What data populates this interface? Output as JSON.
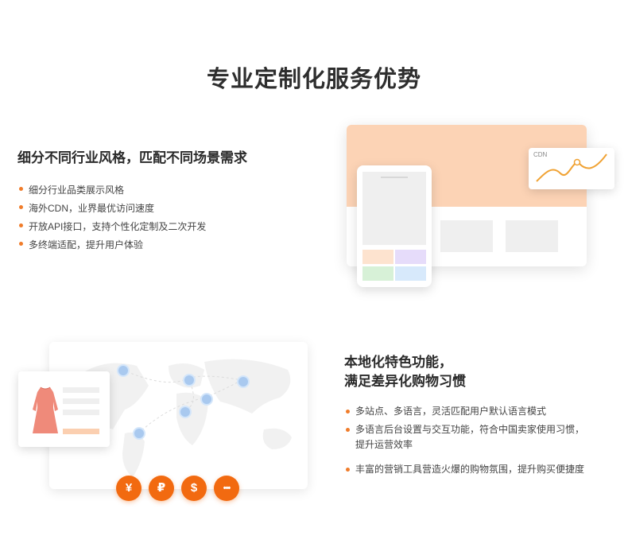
{
  "page_title": "专业定制化服务优势",
  "section1": {
    "heading": "细分不同行业风格，匹配不同场景需求",
    "bullets": [
      "细分行业品类展示风格",
      "海外CDN，业界最优访问速度",
      "开放API接口，支持个性化定制及二次开发",
      "多终端适配，提升用户体验"
    ],
    "illustration": {
      "cdn_label": "CDN"
    }
  },
  "section2": {
    "heading_line1": "本地化特色功能，",
    "heading_line2": "满足差异化购物习惯",
    "bullets": [
      "多站点、多语言，灵活匹配用户默认语言模式",
      "多语言后台设置与交互功能，符合中国卖家使用习惯，提升运营效率",
      "丰富的营销工具营造火爆的购物氛围，提升购买便捷度"
    ],
    "currency_buttons": [
      "¥",
      "₽",
      "$",
      "•••"
    ]
  },
  "colors": {
    "accent": "#f26a10",
    "bullet": "#f07c2a",
    "peach": "#fcd3b5",
    "pin": "#a9c9ef"
  }
}
